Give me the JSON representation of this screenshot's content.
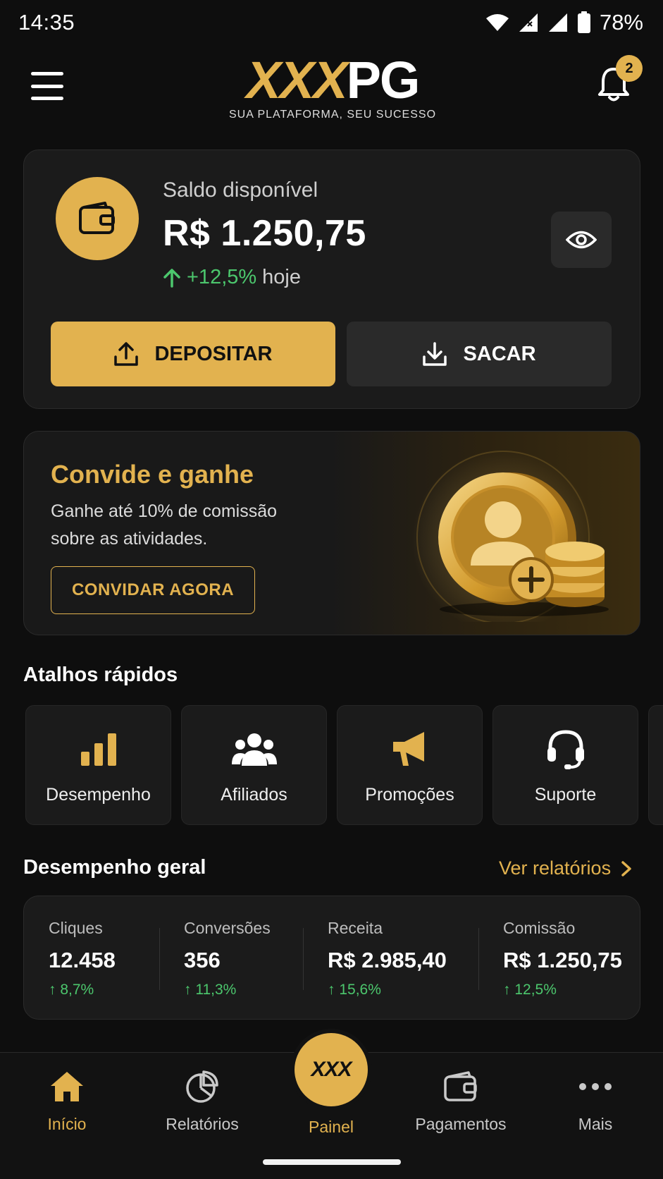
{
  "status_bar": {
    "time": "14:35",
    "battery": "78%"
  },
  "header": {
    "logo_gold": "XXX",
    "logo_white": "PG",
    "tagline": "SUA PLATAFORMA, SEU SUCESSO",
    "notification_count": "2"
  },
  "balance": {
    "label": "Saldo disponível",
    "value": "R$ 1.250,75",
    "change": "+12,5%",
    "change_period": "hoje",
    "deposit_label": "DEPOSITAR",
    "withdraw_label": "SACAR"
  },
  "invite": {
    "title": "Convide e ganhe",
    "description": "Ganhe até 10% de comissão sobre as atividades.",
    "button_label": "CONVIDAR AGORA"
  },
  "shortcuts": {
    "title": "Atalhos rápidos",
    "items": [
      {
        "label": "Desempenho",
        "icon": "bar-chart-icon"
      },
      {
        "label": "Afiliados",
        "icon": "users-icon"
      },
      {
        "label": "Promoções",
        "icon": "megaphone-icon"
      },
      {
        "label": "Suporte",
        "icon": "headset-icon"
      }
    ]
  },
  "performance": {
    "title": "Desempenho geral",
    "see_reports": "Ver relatórios",
    "metrics": [
      {
        "label": "Cliques",
        "value": "12.458",
        "change": "↑ 8,7%"
      },
      {
        "label": "Conversões",
        "value": "356",
        "change": "↑ 11,3%"
      },
      {
        "label": "Receita",
        "value": "R$ 2.985,40",
        "change": "↑ 15,6%"
      },
      {
        "label": "Comissão",
        "value": "R$ 1.250,75",
        "change": "↑ 12,5%"
      }
    ]
  },
  "bottom_nav": {
    "items": [
      {
        "label": "Início",
        "icon": "home-icon",
        "active": true
      },
      {
        "label": "Relatórios",
        "icon": "pie-chart-icon",
        "active": false
      },
      {
        "label": "Painel",
        "icon": "xxx-logo-icon",
        "active": true
      },
      {
        "label": "Pagamentos",
        "icon": "wallet-icon",
        "active": false
      },
      {
        "label": "Mais",
        "icon": "more-dots-icon",
        "active": false
      }
    ],
    "center_mark": "XXX"
  },
  "colors": {
    "accent": "#e2b24f",
    "positive": "#4cc76d",
    "background": "#0e0e0e",
    "card": "#1b1b1b"
  }
}
